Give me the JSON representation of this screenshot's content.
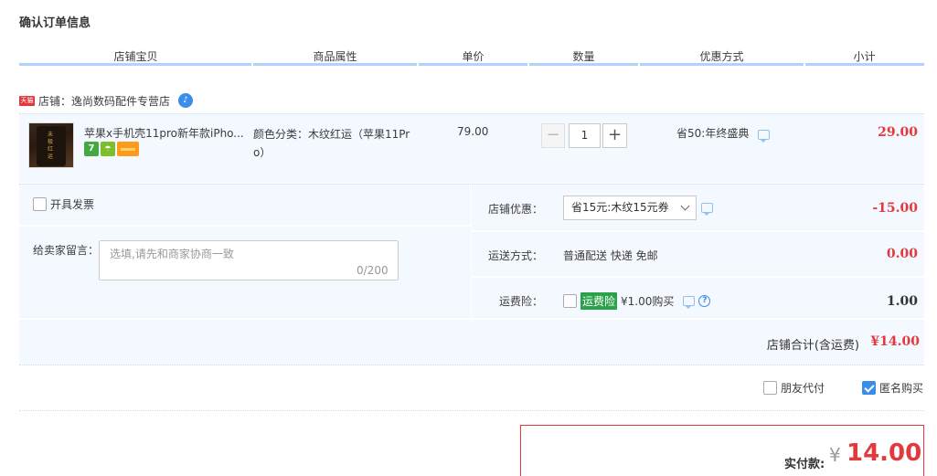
{
  "page_title": "确认订单信息",
  "columns": [
    "店铺宝贝",
    "商品属性",
    "单价",
    "数量",
    "优惠方式",
    "小计"
  ],
  "shop": {
    "badge": "天猫",
    "label": "店铺：逸尚数码配件专营店"
  },
  "item": {
    "image_text": "未极红运",
    "title": "苹果x手机壳11pro新年款iPho...",
    "service_seven": "7",
    "attribute": "颜色分类：木纹红运（苹果11Pro）",
    "unit_price": "79.00",
    "quantity": "1",
    "minus": "−",
    "plus": "+",
    "discount": "省50:年终盛典",
    "subtotal": "29.00"
  },
  "invoice": {
    "label": "开具发票"
  },
  "message": {
    "label": "给卖家留言：",
    "placeholder": "选填,请先和商家协商一致",
    "count": "0/200"
  },
  "coupon": {
    "label": "店铺优惠：",
    "selected": "省15元:木纹15元券",
    "amount": "-15.00"
  },
  "shipping": {
    "label": "运送方式：",
    "method": "普通配送 快递 免邮",
    "amount": "0.00"
  },
  "insurance": {
    "label": "运费险：",
    "tag": "运费险",
    "text": "¥1.00购买",
    "amount": "1.00",
    "help": "?"
  },
  "shop_total": {
    "label": "店铺合计(含运费)",
    "amount": "¥14.00"
  },
  "friend_pay": {
    "label": "朋友代付"
  },
  "anonymous": {
    "label": "匿名购买",
    "checked": true
  },
  "payment": {
    "label": "实付款:",
    "currency": "¥",
    "amount": "14.00"
  }
}
